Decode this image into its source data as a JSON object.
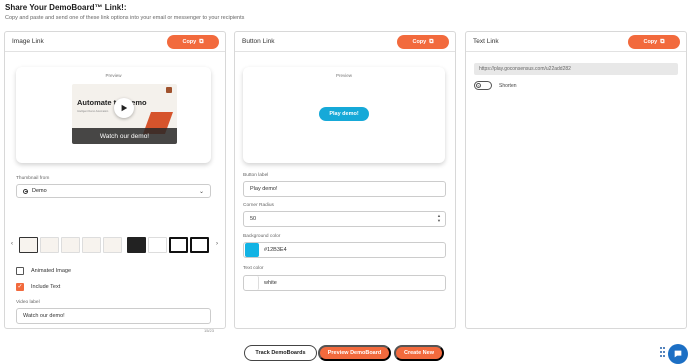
{
  "header": {
    "title": "Share Your DemoBoard™ Link!:",
    "subtitle": "Copy and paste and send one of these link options into your email or messenger to your recipients"
  },
  "copy_label": "Copy",
  "image_link": {
    "title": "Image Link",
    "preview_label": "Preview",
    "thumb_title": "Automate  tro Demo",
    "thumb_sub": "Intelligent Demo Automation",
    "thumb_caption": "Watch our demo!",
    "thumbnail_from_label": "Thumbnail from",
    "thumbnail_from_value": "Demo",
    "animated_image_label": "Animated Image",
    "animated_image_checked": false,
    "include_text_label": "Include Text",
    "include_text_checked": true,
    "video_label_label": "Video label",
    "video_label_value": "Watch our demo!",
    "char_count": "15/23"
  },
  "button_link": {
    "title": "Button Link",
    "preview_label": "Preview",
    "play_button_label": "Play demo!",
    "button_label_label": "Button label",
    "button_label_value": "Play demo!",
    "corner_radius_label": "Corner Radius",
    "corner_radius_value": "50",
    "background_color_label": "Background color",
    "background_color_value": "#12B3E4",
    "text_color_label": "Text color",
    "text_color_value": "white"
  },
  "text_link": {
    "title": "Text Link",
    "url": "https://play.goconsensus.com/u22add282",
    "shorten_label": "Shorten",
    "shorten_on": false
  },
  "footer": {
    "track_label": "Track DemoBoards",
    "preview_label": "Preview DemoBoard",
    "create_label": "Create New"
  },
  "colors": {
    "accent": "#f26a3d",
    "button_preview": "#16a9d8",
    "swatch": "#12B3E4",
    "chat": "#1c6fc4"
  },
  "icons": [
    "copy-icon",
    "play-icon",
    "radio-icon",
    "chevron-down-icon",
    "chevron-left-icon",
    "chevron-right-icon",
    "check-icon",
    "spinner-icon",
    "toggle-icon",
    "grip-icon",
    "chat-icon"
  ]
}
